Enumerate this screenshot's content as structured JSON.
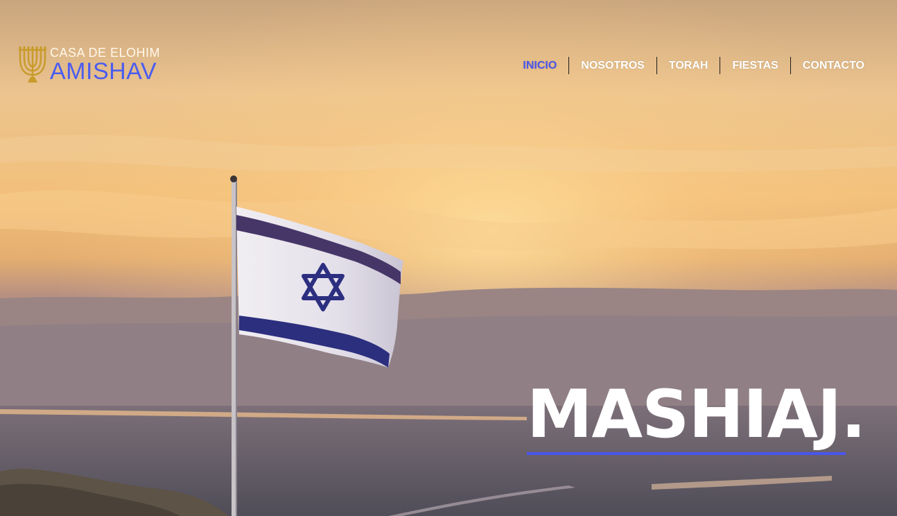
{
  "brand": {
    "line1": "CASA DE ELOHIM",
    "line2": "AMISHAV",
    "icon": "menorah-icon",
    "accent_color": "#4a5cf0",
    "icon_color": "#c89b2a"
  },
  "nav": {
    "items": [
      {
        "label": "INICIO",
        "active": true
      },
      {
        "label": "NOSOTROS",
        "active": false
      },
      {
        "label": "TORAH",
        "active": false
      },
      {
        "label": "FIESTAS",
        "active": false
      },
      {
        "label": "CONTACTO",
        "active": false
      }
    ],
    "active_color": "#4a55ee"
  },
  "hero": {
    "headline": "MASHIAJ.",
    "background": "sunset-over-desert-with-israeli-flag",
    "flag_icon": "israel-flag"
  }
}
